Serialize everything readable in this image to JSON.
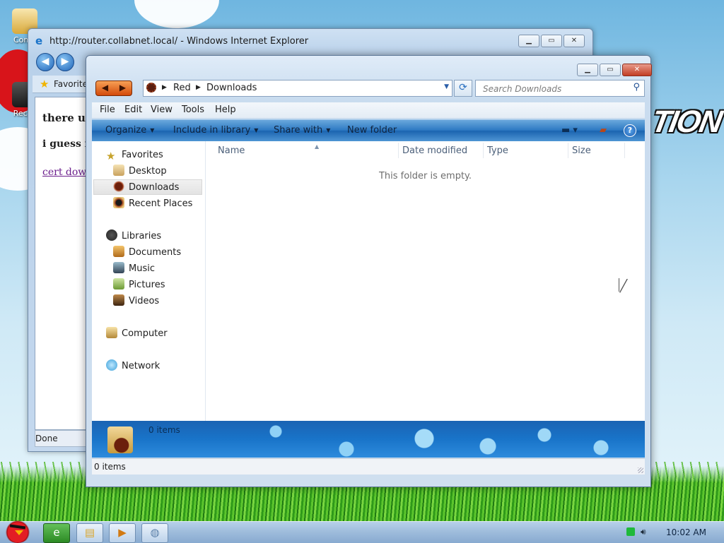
{
  "desktop": {
    "icons": [
      {
        "label": "Comp"
      },
      {
        "label": "Recyc"
      }
    ],
    "wallpaper_text": "TION"
  },
  "ie_window": {
    "title": "http://router.collabnet.local/ - Windows Internet Explorer",
    "favorites_label": "Favorite",
    "content": {
      "line1": "there use",
      "line2": "i guess it",
      "link": "cert downl"
    },
    "status": "Done"
  },
  "explorer": {
    "nav_buttons": {
      "back": "◀",
      "forward": "▶"
    },
    "breadcrumb": [
      "Red",
      "Downloads"
    ],
    "search_placeholder": "Search Downloads",
    "menu": [
      "File",
      "Edit",
      "View",
      "Tools",
      "Help"
    ],
    "commands": {
      "organize": "Organize",
      "include_library": "Include in library",
      "share_with": "Share with",
      "new_folder": "New folder"
    },
    "nav_pane": {
      "favorites": "Favorites",
      "favorites_items": [
        "Desktop",
        "Downloads",
        "Recent Places"
      ],
      "libraries": "Libraries",
      "libraries_items": [
        "Documents",
        "Music",
        "Pictures",
        "Videos"
      ],
      "computer": "Computer",
      "network": "Network",
      "selected": "Downloads"
    },
    "columns": [
      "Name",
      "Date modified",
      "Type",
      "Size"
    ],
    "empty_message": "This folder is empty.",
    "details_text": "0 items",
    "status_text": "0 items"
  },
  "taskbar": {
    "clock": "10:02 AM"
  },
  "colors": {
    "command_bar": "#2d79c3",
    "details_pane": "#1974c9",
    "selection": "#e3e3e3",
    "start_button": "#e31d24"
  }
}
